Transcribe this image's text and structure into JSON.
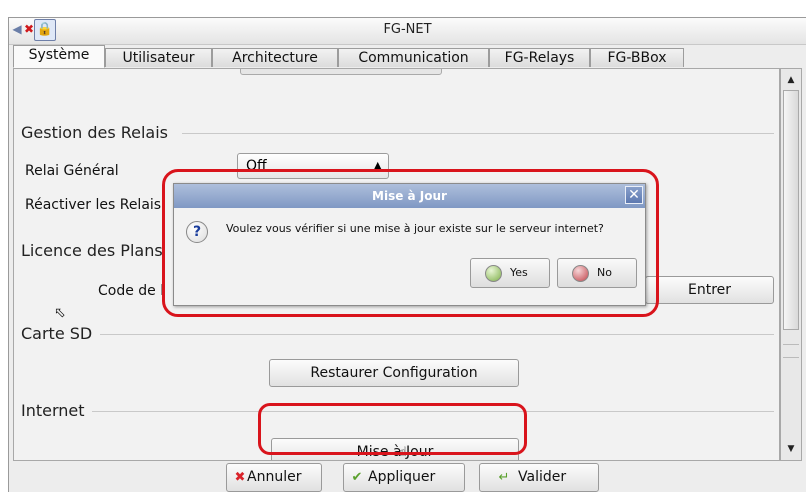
{
  "window": {
    "title": "FG-NET"
  },
  "title_icons": {
    "speaker": "speaker-icon",
    "close": "close-icon",
    "lock": "lock-icon"
  },
  "tabs": [
    {
      "label": "Système",
      "active": true
    },
    {
      "label": "Utilisateur"
    },
    {
      "label": "Architecture"
    },
    {
      "label": "Communication"
    },
    {
      "label": "FG-Relays"
    },
    {
      "label": "FG-BBox"
    }
  ],
  "sections": {
    "relais": {
      "title": "Gestion des Relais",
      "relai_general_label": "Relai Général",
      "relai_general_value": "Off",
      "reactiver_label": "Réactiver les Relais"
    },
    "licence": {
      "title": "Licence des Plans",
      "code_label": "Code de l",
      "entrer_button": "Entrer"
    },
    "carte_sd": {
      "title": "Carte SD",
      "restaurer_button": "Restaurer Configuration"
    },
    "internet": {
      "title": "Internet",
      "mise_a_jour_button": "Mise à Jour"
    }
  },
  "bottom_buttons": {
    "annuler": "Annuler",
    "appliquer": "Appliquer",
    "valider": "Valider"
  },
  "dialog": {
    "title": "Mise à Jour",
    "message": "Voulez vous vérifier si une mise à jour existe sur le serveur internet?",
    "yes_label": "Yes",
    "no_label": "No",
    "yes_color": "#7fb04a",
    "no_color": "#c2444b"
  },
  "annotation_color": "#d9141c"
}
